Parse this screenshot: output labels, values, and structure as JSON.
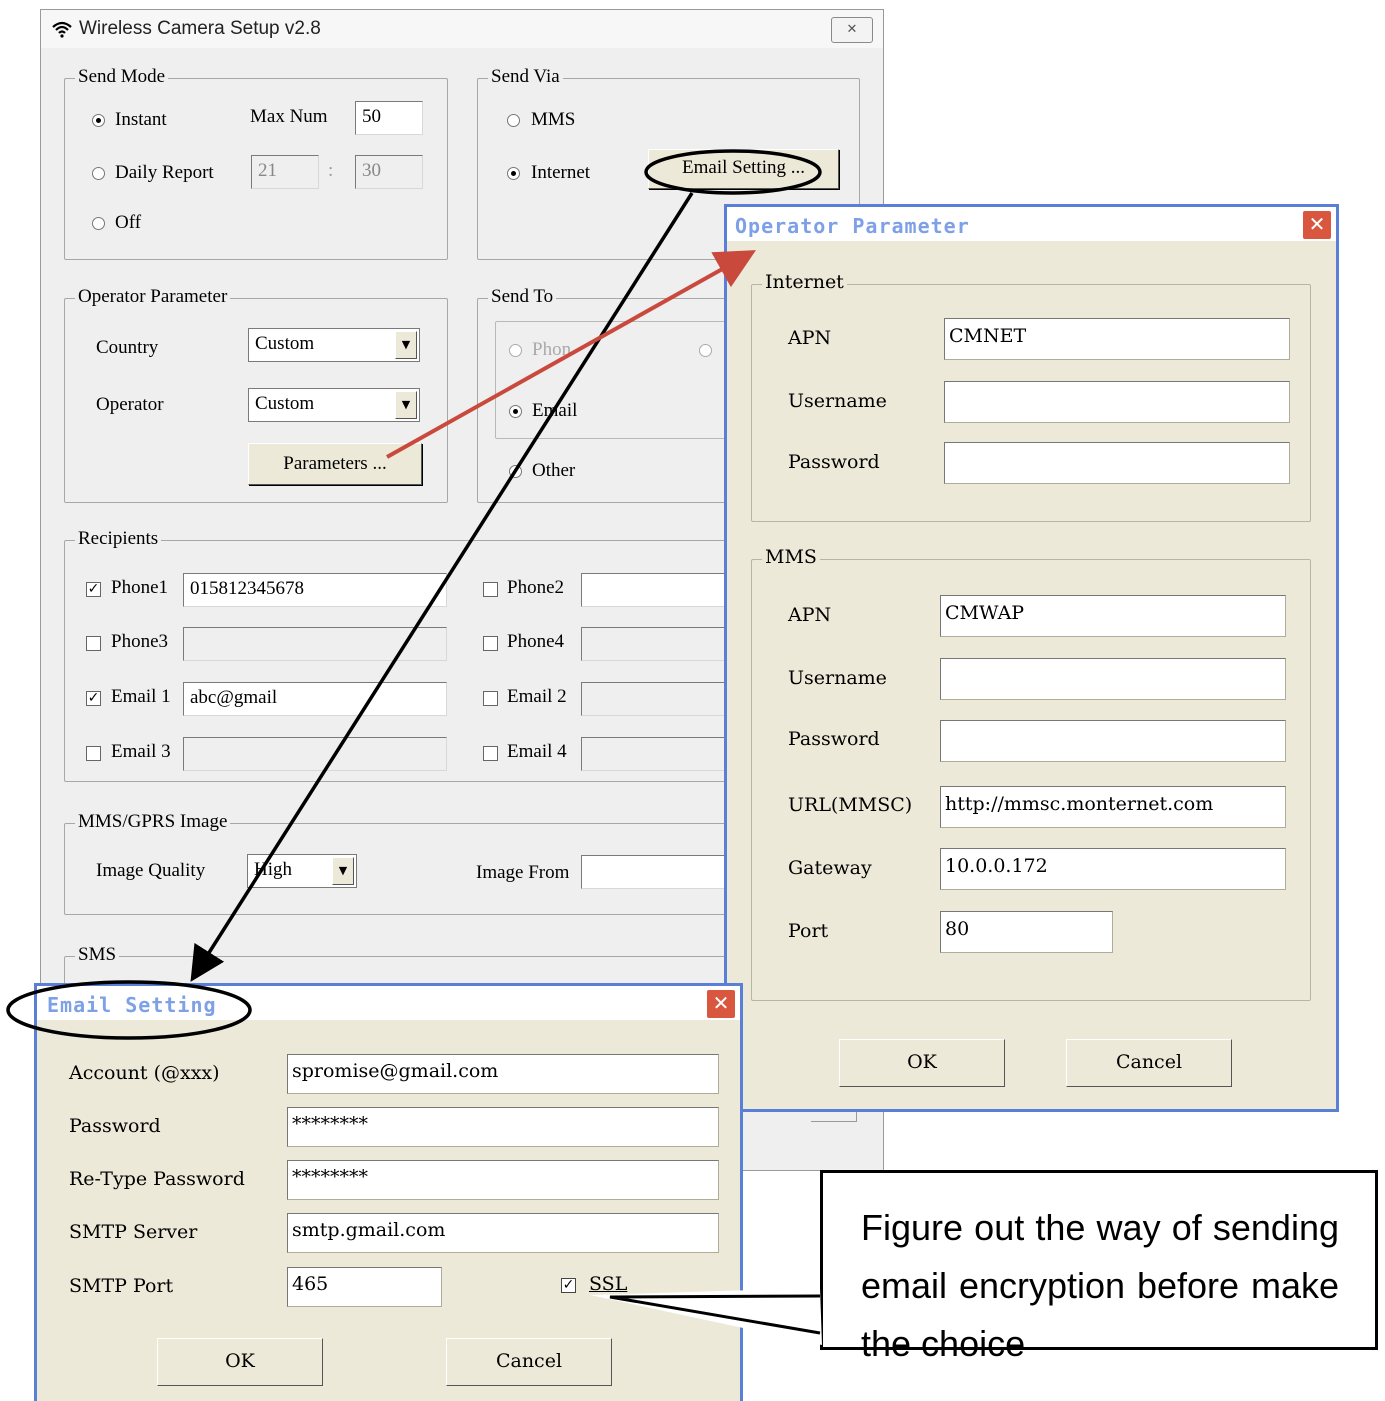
{
  "main": {
    "title": "Wireless Camera Setup  v2.8",
    "send_mode": {
      "legend": "Send Mode",
      "instant": "Instant",
      "max_num_label": "Max Num",
      "max_num": "50",
      "daily_report": "Daily Report",
      "hour": "21",
      "sep": ":",
      "minute": "30",
      "off": "Off",
      "selected": "Instant"
    },
    "send_via": {
      "legend": "Send Via",
      "mms": "MMS",
      "internet": "Internet",
      "email_setting_button": "Email Setting ...",
      "selected": "Internet"
    },
    "operator_parameter": {
      "legend": "Operator Parameter",
      "country_label": "Country",
      "country_value": "Custom",
      "operator_label": "Operator",
      "operator_value": "Custom",
      "parameters_button": "Parameters ..."
    },
    "send_to": {
      "legend": "Send To",
      "phone": "Phon",
      "email": "Email",
      "other": "Other",
      "selected": "Email"
    },
    "recipients": {
      "legend": "Recipients",
      "items": [
        {
          "label": "Phone1",
          "checked": "true",
          "value": "015812345678"
        },
        {
          "label": "Phone2",
          "checked": "false",
          "value": ""
        },
        {
          "label": "Phone3",
          "checked": "false",
          "value": ""
        },
        {
          "label": "Phone4",
          "checked": "false",
          "value": ""
        },
        {
          "label": "Email 1",
          "checked": "true",
          "value": "abc@gmail"
        },
        {
          "label": "Email 2",
          "checked": "false",
          "value": ""
        },
        {
          "label": "Email 3",
          "checked": "false",
          "value": ""
        },
        {
          "label": "Email 4",
          "checked": "false",
          "value": ""
        }
      ]
    },
    "mms_gprs_image": {
      "legend": "MMS/GPRS Image",
      "quality_label": "Image Quality",
      "quality_value": "High",
      "from_label": "Image From"
    },
    "sms": {
      "legend": "SMS"
    }
  },
  "operator_dialog": {
    "title": "Operator Parameter",
    "close": "✕",
    "internet": {
      "legend": "Internet",
      "apn_label": "APN",
      "apn": "CMNET",
      "username_label": "Username",
      "username": "",
      "password_label": "Password",
      "password": ""
    },
    "mms": {
      "legend": "MMS",
      "apn_label": "APN",
      "apn": "CMWAP",
      "username_label": "Username",
      "username": "",
      "password_label": "Password",
      "password": "",
      "url_label": "URL(MMSC)",
      "url": "http://mmsc.monternet.com",
      "gateway_label": "Gateway",
      "gateway": "10.0.0.172",
      "port_label": "Port",
      "port": "80"
    },
    "ok": "OK",
    "cancel": "Cancel"
  },
  "email_dialog": {
    "title": "Email Setting",
    "close": "✕",
    "account_label": "Account (@xxx)",
    "account": "spromise@gmail.com",
    "password_label": "Password",
    "password": "********",
    "retype_label": "Re-Type Password",
    "retype": "********",
    "smtp_server_label": "SMTP Server",
    "smtp_server": "smtp.gmail.com",
    "smtp_port_label": "SMTP Port",
    "smtp_port": "465",
    "ssl_label": "SSL",
    "ssl_checked": "true",
    "ok": "OK",
    "cancel": "Cancel"
  },
  "callout": {
    "text": "Figure out the way of sending email encryption before make the choice"
  },
  "colors": {
    "arrow_black": "#000000",
    "arrow_red": "#c9493c",
    "dialog_border": "#5a7fd6",
    "dialog_title_text": "#7ea0e6",
    "close_button": "#d9573e"
  }
}
